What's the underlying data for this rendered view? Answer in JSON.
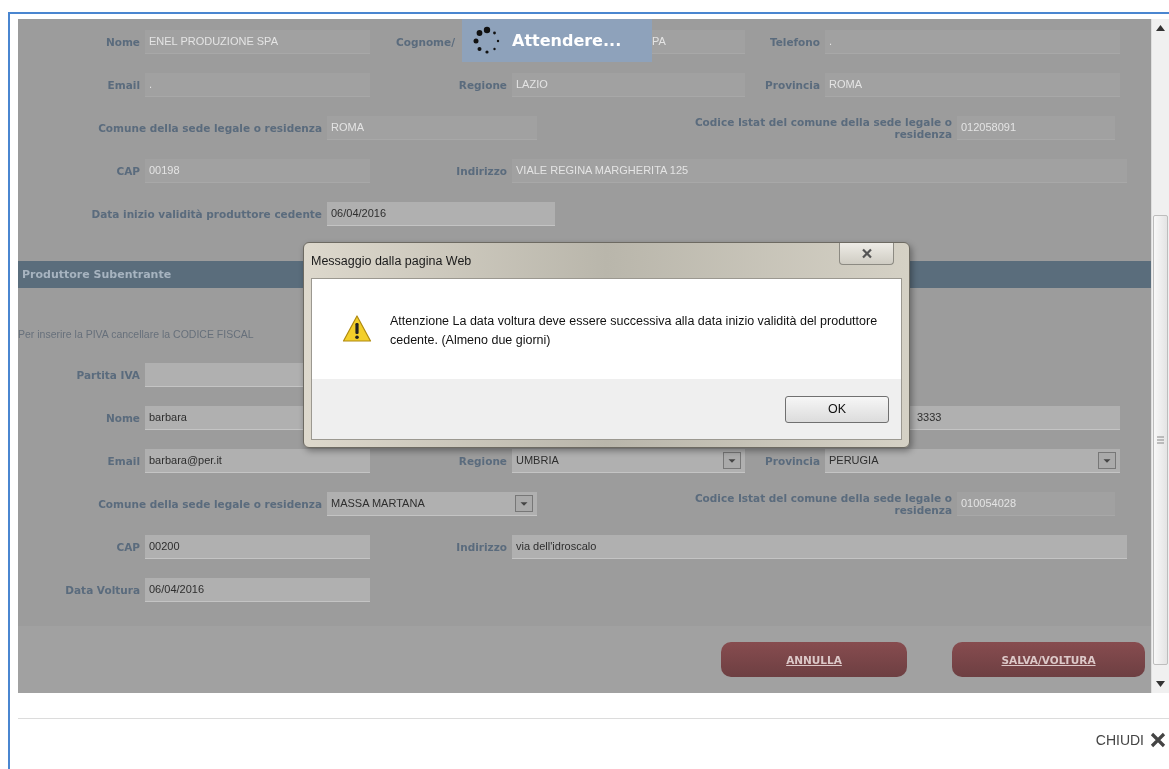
{
  "loading": {
    "text": "Attendere..."
  },
  "sections": [
    {
      "rows": [
        {
          "kind": "triple",
          "items": [
            {
              "label": "Nome",
              "value": "ENEL PRODUZIONE SPA",
              "disabled": true
            },
            {
              "label": "Cognome/",
              "value": "PA",
              "disabled": true,
              "cut": true
            },
            {
              "label": "Telefono",
              "value": ".",
              "disabled": true
            }
          ]
        },
        {
          "kind": "triple",
          "items": [
            {
              "label": "Email",
              "value": ".",
              "disabled": true
            },
            {
              "label": "Regione",
              "value": "LAZIO",
              "disabled": true
            },
            {
              "label": "Provincia",
              "value": "ROMA",
              "disabled": true
            }
          ]
        },
        {
          "kind": "wide-pair",
          "items": [
            {
              "label": "Comune della sede legale o residenza",
              "value": "ROMA",
              "disabled": true
            },
            {
              "label": "Codice Istat del comune della sede legale o residenza",
              "value": "012058091",
              "disabled": true
            }
          ]
        },
        {
          "kind": "cap",
          "items": [
            {
              "label": "CAP",
              "value": "00198",
              "disabled": true
            },
            {
              "label": "Indirizzo",
              "value": "VIALE REGINA MARGHERITA 125",
              "disabled": true
            }
          ]
        },
        {
          "kind": "long-single",
          "items": [
            {
              "label": "Data inizio validità produttore cedente",
              "value": "06/04/2016",
              "disabled": false
            }
          ]
        }
      ]
    },
    {
      "title": "Produttore Subentrante",
      "note": "Per inserire la PIVA cancellare la CODICE FISCAL",
      "rows": [
        {
          "kind": "single",
          "items": [
            {
              "label": "Partita IVA",
              "disabled": false
            }
          ]
        },
        {
          "kind": "triple-gap",
          "items": [
            {
              "label": "Nome",
              "value": "barbara",
              "disabled": false
            },
            {
              "value": "3333",
              "disabled": false,
              "cut": true
            }
          ]
        },
        {
          "kind": "triple",
          "items": [
            {
              "label": "Email",
              "value": "barbara@per.it",
              "disabled": false
            },
            {
              "label": "Regione",
              "value": "UMBRIA",
              "disabled": false,
              "dropdown": true
            },
            {
              "label": "Provincia",
              "value": "PERUGIA",
              "disabled": false,
              "dropdown": true
            }
          ]
        },
        {
          "kind": "wide-pair",
          "items": [
            {
              "label": "Comune della sede legale o residenza",
              "value": "MASSA MARTANA",
              "disabled": false,
              "dropdown": true
            },
            {
              "label": "Codice Istat del comune della sede legale o residenza",
              "value": "010054028",
              "disabled": true
            }
          ]
        },
        {
          "kind": "cap",
          "items": [
            {
              "label": "CAP",
              "value": "00200",
              "disabled": false
            },
            {
              "label": "Indirizzo",
              "value": "via dell'idroscalo",
              "disabled": false
            }
          ]
        },
        {
          "kind": "single",
          "items": [
            {
              "label": "Data Voltura",
              "value": "06/04/2016",
              "disabled": false
            }
          ]
        }
      ]
    }
  ],
  "actions": [
    {
      "label": "ANNULLA"
    },
    {
      "label": "SALVA/VOLTURA"
    }
  ],
  "dialog": {
    "title": "Messaggio dalla pagina Web",
    "message": "Attenzione La data voltura deve essere successiva alla data inizio validità del produttore cedente. (Almeno due giorni)",
    "ok": "OK"
  },
  "footer": {
    "close_label": "CHIUDI"
  }
}
